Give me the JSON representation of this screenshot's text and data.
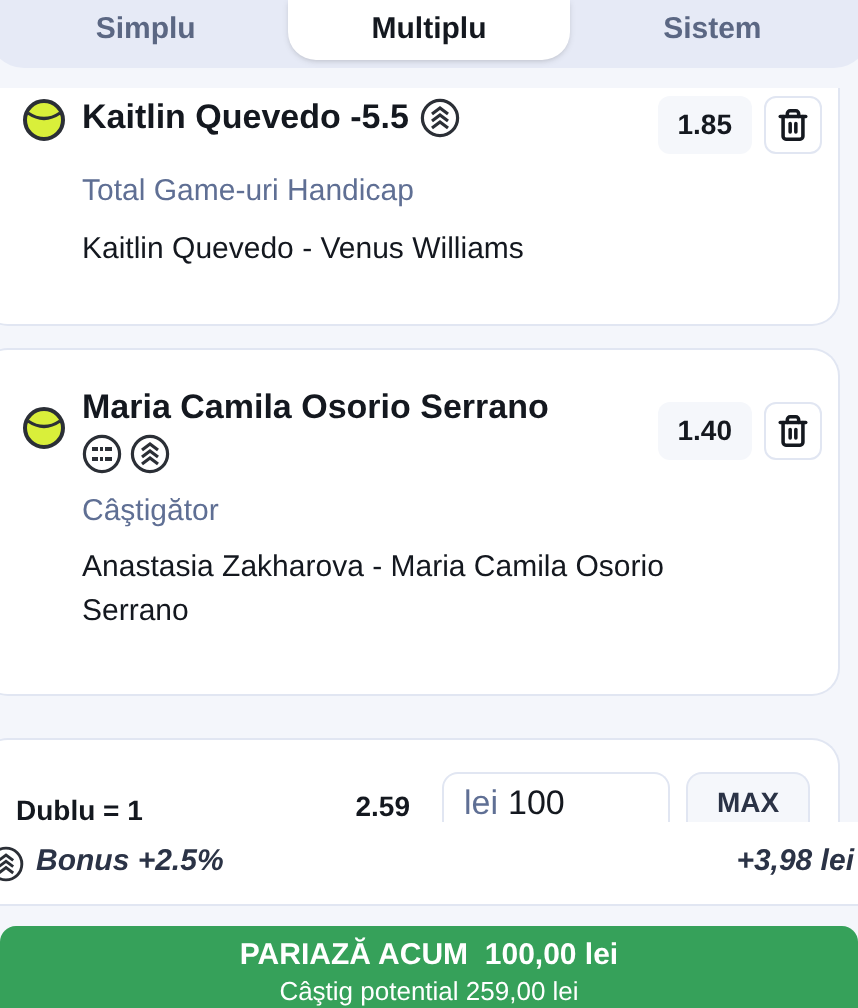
{
  "tabs": [
    {
      "label": "Simplu",
      "selected": false
    },
    {
      "label": "Multiplu",
      "selected": true
    },
    {
      "label": "Sistem",
      "selected": false
    }
  ],
  "selections": [
    {
      "title": "Kaitlin Quevedo -5.5",
      "icons": [
        {
          "kind": "boost"
        }
      ],
      "odds": "1.85",
      "market": "Total Game-uri Handicap",
      "match": "Kaitlin Quevedo - Venus Williams"
    },
    {
      "title": "Maria Camila Osorio Serrano",
      "icons": [
        {
          "kind": "score"
        },
        {
          "kind": "boost"
        }
      ],
      "odds": "1.40",
      "market": "Câştigător",
      "match": "Anastasia Zakharova - Maria Camila Osorio Serrano"
    }
  ],
  "stake": {
    "label": "Dublu = 1",
    "odds": "2.59",
    "currency": "lei",
    "amount": "100",
    "max": "MAX"
  },
  "bonus": {
    "label": "Bonus +2.5%",
    "amount": "+3,98 lei"
  },
  "bet_button": {
    "label": "PARIAZĂ ACUM  100,00 lei",
    "potential": "Câştig potential 259,00 lei"
  }
}
